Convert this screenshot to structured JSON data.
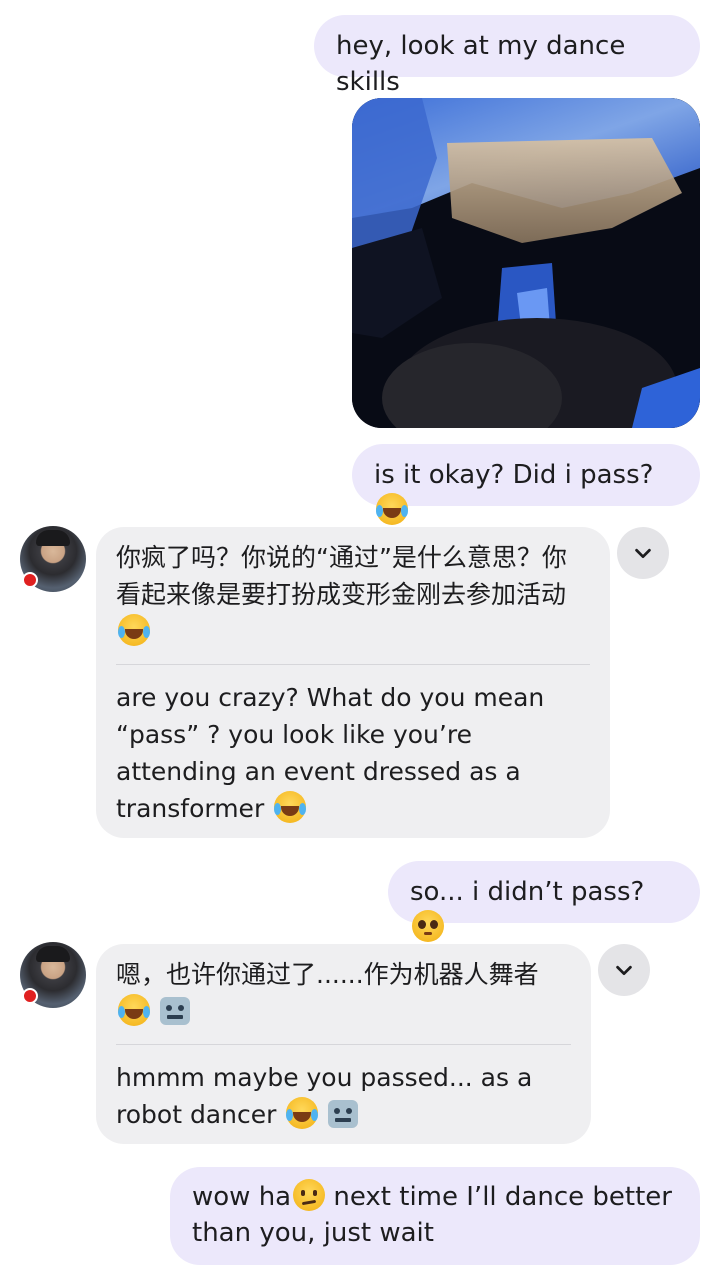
{
  "messages": {
    "m1": {
      "text": "hey, look at my dance skills"
    },
    "m2": {
      "text": "is it okay? Did i pass?"
    },
    "m3": {
      "original": "你疯了吗？你说的“通过”是什么意思？你看起来像是要打扮成变形金刚去参加活动",
      "translation": "are you crazy? What do you mean “pass” ? you look like you’re attending an event dressed as a transformer"
    },
    "m4": {
      "text": "so... i didn’t pass?"
    },
    "m5": {
      "original": "嗯，也许你通过了......作为机器人舞者",
      "translation": "hmmm maybe you passed... as a robot dancer"
    },
    "m6": {
      "text_before": "wow ha",
      "text_after": " next time I’ll dance better than you, just wait"
    }
  },
  "icons": {
    "emoji_joy": "face-with-tears-of-joy",
    "emoji_plead": "pleading-face",
    "emoji_robot": "robot-face",
    "emoji_raised": "face-with-raised-eyebrow",
    "options": "chevron-down-icon"
  },
  "colors": {
    "outgoing_bubble": "#ece8fb",
    "incoming_bubble": "#efeff1",
    "avatar_badge": "#e02020"
  }
}
